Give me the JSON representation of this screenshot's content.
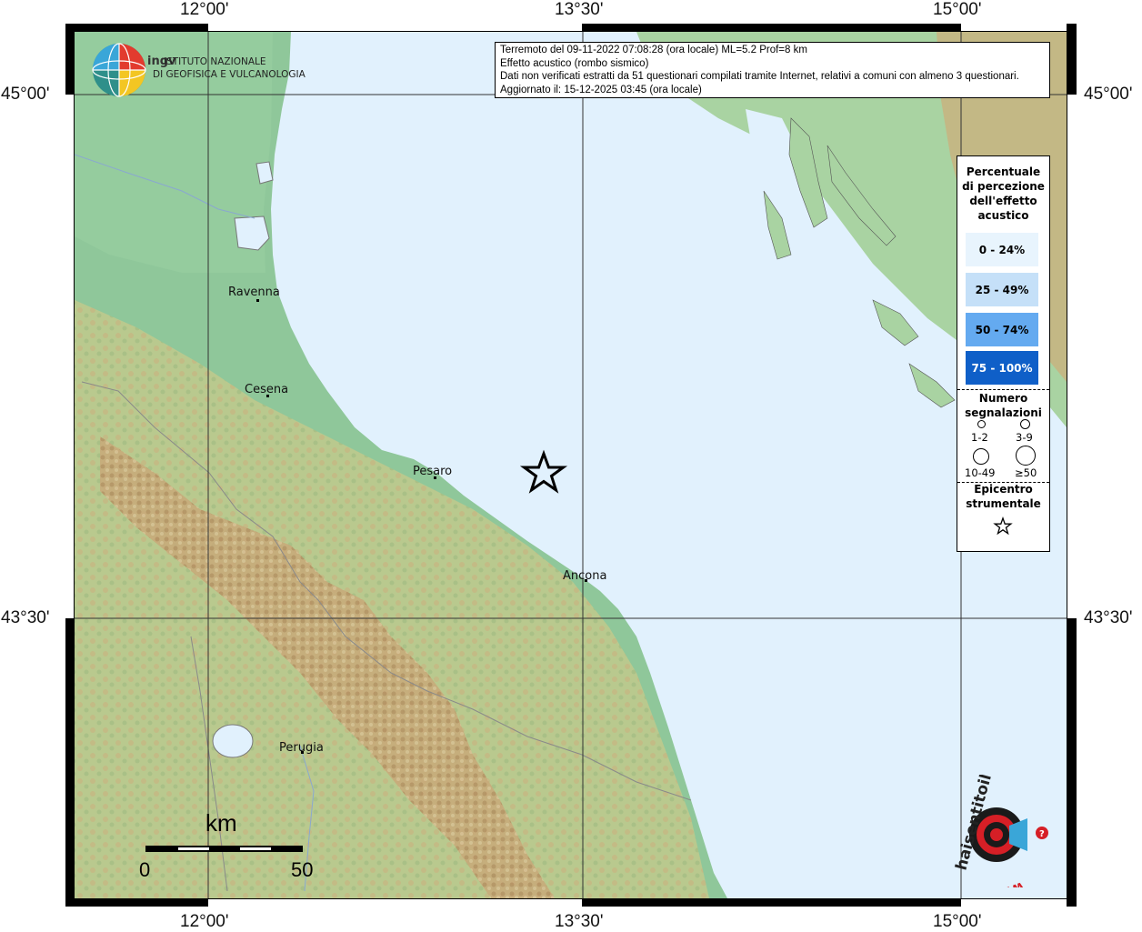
{
  "ticks": {
    "lon_top": [
      "12°00'",
      "13°30'",
      "15°00'"
    ],
    "lon_bottom": [
      "12°00'",
      "13°30'",
      "15°00'"
    ],
    "lat_left": [
      "45°00'",
      "43°30'"
    ],
    "lat_right": [
      "45°00'",
      "43°30'"
    ]
  },
  "logo": {
    "org_line1": "ISTITUTO NAZIONALE",
    "org_line2": "DI GEOFISICA E VULCANOLOGIA",
    "badge": "ingv"
  },
  "info": {
    "line1": "Terremoto del 09-11-2022 07:08:28 (ora locale) ML=5.2 Prof=8 km",
    "line2": "Effetto acustico (rombo sismico)",
    "line3": "Dati non verificati estratti da 51 questionari compilati tramite Internet, relativi a comuni con almeno 3 questionari.",
    "line4": "Aggiornato il: 15-12-2025 03:45 (ora locale)"
  },
  "legend": {
    "title_lines": [
      "Percentuale",
      "di percezione",
      "dell'effetto",
      "acustico"
    ],
    "classes": [
      {
        "label": "0 - 24%",
        "color": "#e8f4fd",
        "text_color": "#000000"
      },
      {
        "label": "25 - 49%",
        "color": "#c5e0f8",
        "text_color": "#000000"
      },
      {
        "label": "50 - 74%",
        "color": "#64aaf0",
        "text_color": "#000000"
      },
      {
        "label": "75 - 100%",
        "color": "#0f5fc8",
        "text_color": "#ffffff"
      }
    ],
    "count_title_lines": [
      "Numero",
      "segnalazioni"
    ],
    "counts": [
      "1-2",
      "3-9",
      "10-49",
      "≥50"
    ],
    "epicenter_title_lines": [
      "Epicentro",
      "strumentale"
    ]
  },
  "cities": [
    "Ravenna",
    "Cesena",
    "Pesaro",
    "Ancona",
    "Perugia"
  ],
  "scale": {
    "unit": "km",
    "start": "0",
    "end": "50"
  },
  "colors": {
    "sea": "#e1f1fd",
    "lowland": "#8fc79a",
    "hills": "#b7c98c",
    "mountains": "#c9a77b",
    "croatia": "#a9d3a2"
  },
  "website_logo": {
    "text": "haisentitoilterremoto.it",
    "url_text": "www."
  }
}
